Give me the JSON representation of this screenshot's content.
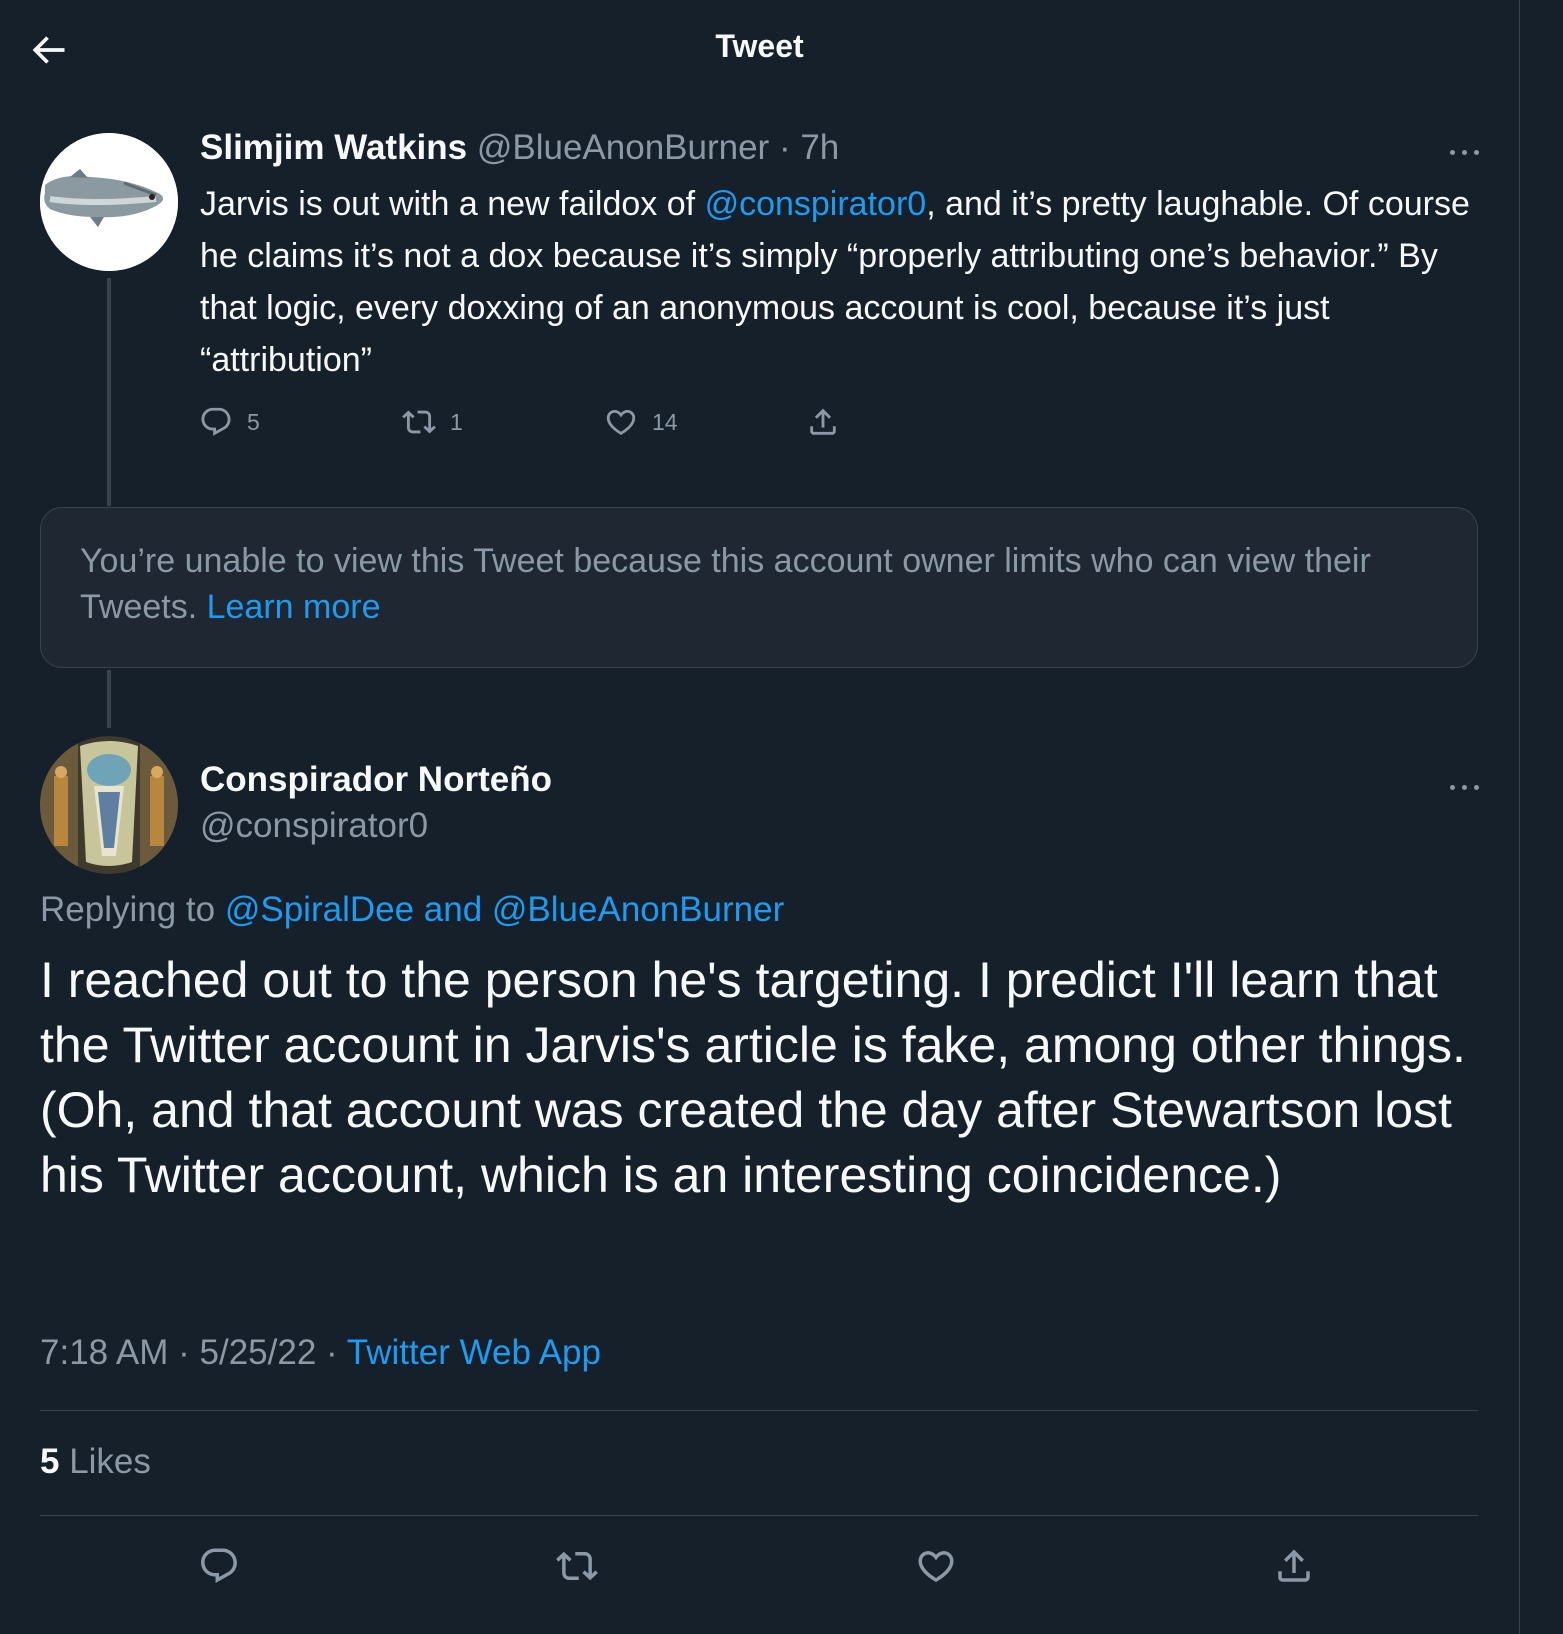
{
  "header": {
    "title": "Tweet",
    "back_icon": "arrow-left-icon"
  },
  "parent_tweet": {
    "display_name": "Slimjim Watkins",
    "handle": "@BlueAnonBurner",
    "separator": " · ",
    "time": "7h",
    "body_1": "Jarvis is out with a new faildox of ",
    "mention": "@conspirator0",
    "body_2": ", and it’s pretty laughable. Of course he claims it’s not a dox because it’s simply “properly attributing one’s behavior.” By that logic, every doxxing of an anonymous account is cool, because it’s just “attribution”",
    "replies": "5",
    "retweets": "1",
    "likes": "14"
  },
  "notice": {
    "text": "You’re unable to view this Tweet because this account owner limits who can view their Tweets. ",
    "link": "Learn more"
  },
  "main_tweet": {
    "display_name": "Conspirador Norteño",
    "handle": "@conspirator0",
    "replying_prefix": "Replying to ",
    "replying_mentions": "@SpiralDee and @BlueAnonBurner",
    "body": "I reached out to the person he's targeting.  I predict I'll learn that the Twitter account in Jarvis's article is fake, among other things.  (Oh, and that account was created the day after Stewartson lost his Twitter account, which is an interesting coincidence.)",
    "time": "7:18 AM",
    "dot": " · ",
    "date": "5/25/22",
    "source": "Twitter Web App",
    "likes_count": "5",
    "likes_label": " Likes"
  },
  "colors": {
    "background": "#15202b",
    "text": "#f7f9f9",
    "muted": "#8b98a5",
    "accent": "#1d9bf0",
    "border": "#38444d"
  }
}
